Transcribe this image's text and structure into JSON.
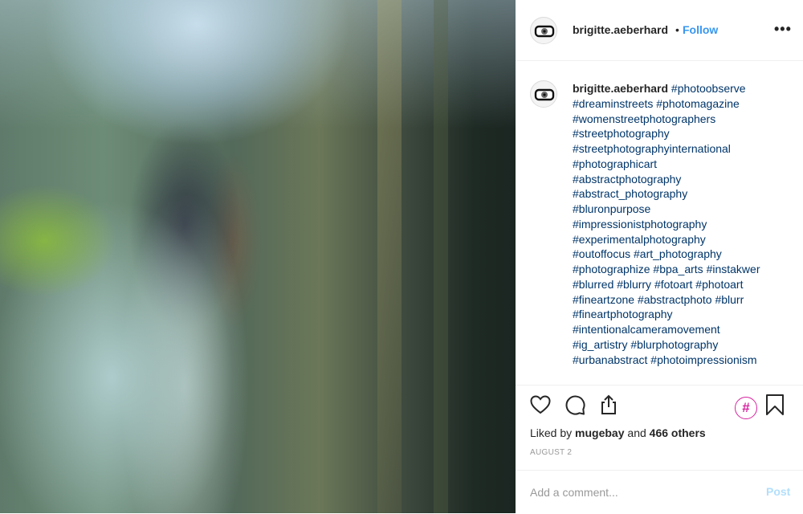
{
  "post": {
    "username": "brigitte.aeberhard",
    "separator": "•",
    "follow_label": "Follow",
    "more_icon": "more-options-icon"
  },
  "caption": {
    "username": "brigitte.aeberhard",
    "lines": [
      "#photoobserve",
      "#dreaminstreets #photomagazine",
      "#womenstreetphotographers",
      "#streetphotography",
      "#streetphotographyinternational",
      "#photographicart",
      "#abstractphotography",
      "#abstract_photography",
      "#bluronpurpose",
      "#impressionistphotography",
      "#experimentalphotography",
      "#outoffocus #art_photography",
      "#photographize #bpa_arts #instakwer",
      "#blurred #blurry #fotoart #photoart",
      "#fineartzone #abstractphoto #blurr",
      "#fineartphotography",
      "#intentionalcameramovement",
      "#ig_artistry #blurphotography",
      "#urbanabstract #photoimpressionism"
    ]
  },
  "actions": {
    "icons": [
      "heart-icon",
      "comment-icon",
      "share-icon",
      "hashtag-icon",
      "bookmark-icon"
    ],
    "hashtag_symbol": "#"
  },
  "likes": {
    "prefix": "Liked by",
    "user": "mugebay",
    "conjunction": "and",
    "others": "466 others"
  },
  "date": "AUGUST 2",
  "comment": {
    "placeholder": "Add a comment...",
    "post_label": "Post"
  },
  "colors": {
    "follow": "#3897f0",
    "hashtag": "#003569",
    "hashtag_badge": "#d6249f",
    "post_disabled": "#b2dffc",
    "muted": "#999999"
  }
}
